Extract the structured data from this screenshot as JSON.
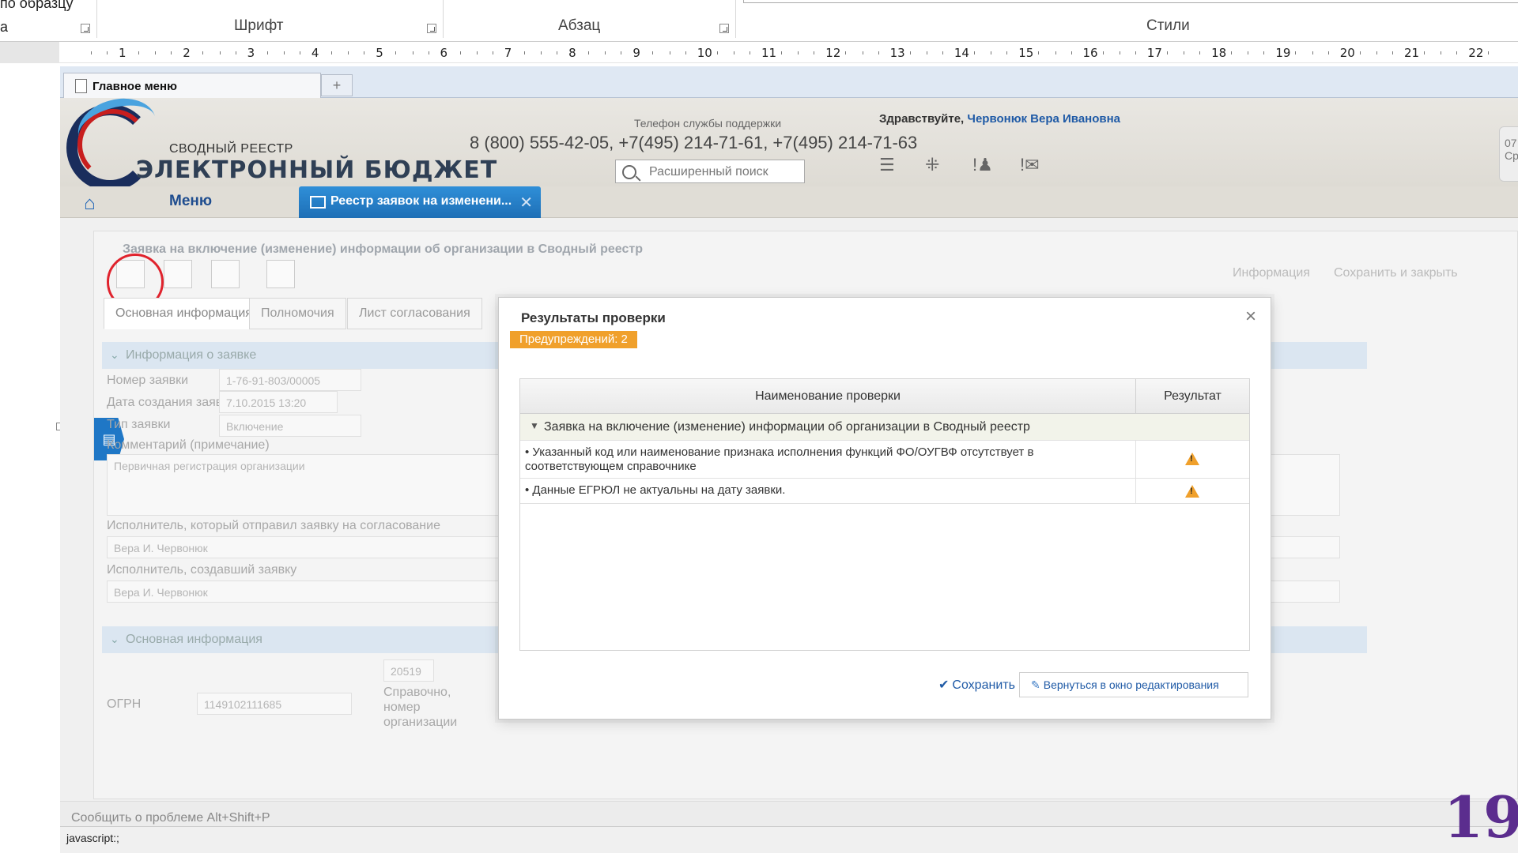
{
  "ribbon": {
    "cut_left_text": "по образцу",
    "left_a": "а",
    "group_font": "Шрифт",
    "group_paragraph": "Абзац",
    "group_styles": "Стили"
  },
  "ruler": {
    "numbers": [
      "1",
      "2",
      "3",
      "4",
      "5",
      "6",
      "7",
      "8",
      "9",
      "10",
      "11",
      "12",
      "13",
      "14",
      "15",
      "16",
      "17",
      "18",
      "19",
      "20",
      "21",
      "22"
    ]
  },
  "browser": {
    "tab_title": "Главное меню",
    "new_tab": "+"
  },
  "header": {
    "logo_sub": "СВОДНЫЙ РЕЕСТР",
    "logo_main": "ЭЛЕКТРОННЫЙ БЮДЖЕТ",
    "support_label": "Телефон службы поддержки",
    "phones": "8 (800) 555-42-05, +7(495) 214-71-61, +7(495) 214-71-63",
    "search_placeholder": "Расширенный поиск",
    "greeting_prefix": "Здравствуйте,",
    "user_name": "Червонюк Вера Ивановна",
    "side_stub": "07 Ср"
  },
  "nav": {
    "menu": "Меню",
    "register_tab": "Реестр заявок на изменени..."
  },
  "form": {
    "title": "Заявка на включение (изменение) информации об организации в Сводный реестр",
    "tabs": [
      "Основная информация",
      "Полномочия",
      "Лист согласования"
    ],
    "right_actions": [
      "Информация",
      "Сохранить и закрыть"
    ],
    "section1": "Информация о заявке",
    "labels": {
      "request_number": "Номер заявки",
      "created_date": "Дата создания заявки",
      "request_type": "Тип заявки",
      "comment": "Комментарий (примечание)",
      "sent_by": "Исполнитель, который отправил заявку на согласование",
      "created_by": "Исполнитель, создавший заявку",
      "ogrn": "ОГРН",
      "ref_number": "Справочно, номер организации"
    },
    "values": {
      "request_number": "1-76-91-803/00005",
      "created_date": "7.10.2015 13:20",
      "request_type": "Включение",
      "comment": "Первичная регистрация организации",
      "sent_by": "Вера И. Червонюк",
      "created_by": "Вера И. Червонюк",
      "ogrn": "1149102111685",
      "ref_number": "20519"
    },
    "section2": "Основная информация"
  },
  "modal": {
    "title": "Результаты проверки",
    "close": "×",
    "warnings": "Предупреждений: 2",
    "col_name": "Наименование проверки",
    "col_result": "Результат",
    "group": "Заявка на включение (изменение) информации об организации в Сводный реестр",
    "rows": [
      {
        "text": "• Указанный код или наименование признака исполнения функций ФО/ОУГВФ отсутствует в соответствующем справочнике",
        "result": "warning"
      },
      {
        "text": "• Данные ЕГРЮЛ не актуальны на дату заявки.",
        "result": "warning"
      }
    ],
    "save": "Сохранить",
    "back": "Вернуться в окно редактирования"
  },
  "footer": {
    "report": "Сообщить о проблеме Alt+Shift+P",
    "status": "javascript:;",
    "page_number": "19"
  },
  "colors": {
    "accent_blue": "#1f77c6",
    "warning_orange": "#f0a02b",
    "highlight_red": "#e0232d",
    "page_number_purple": "#5b2d8e"
  }
}
